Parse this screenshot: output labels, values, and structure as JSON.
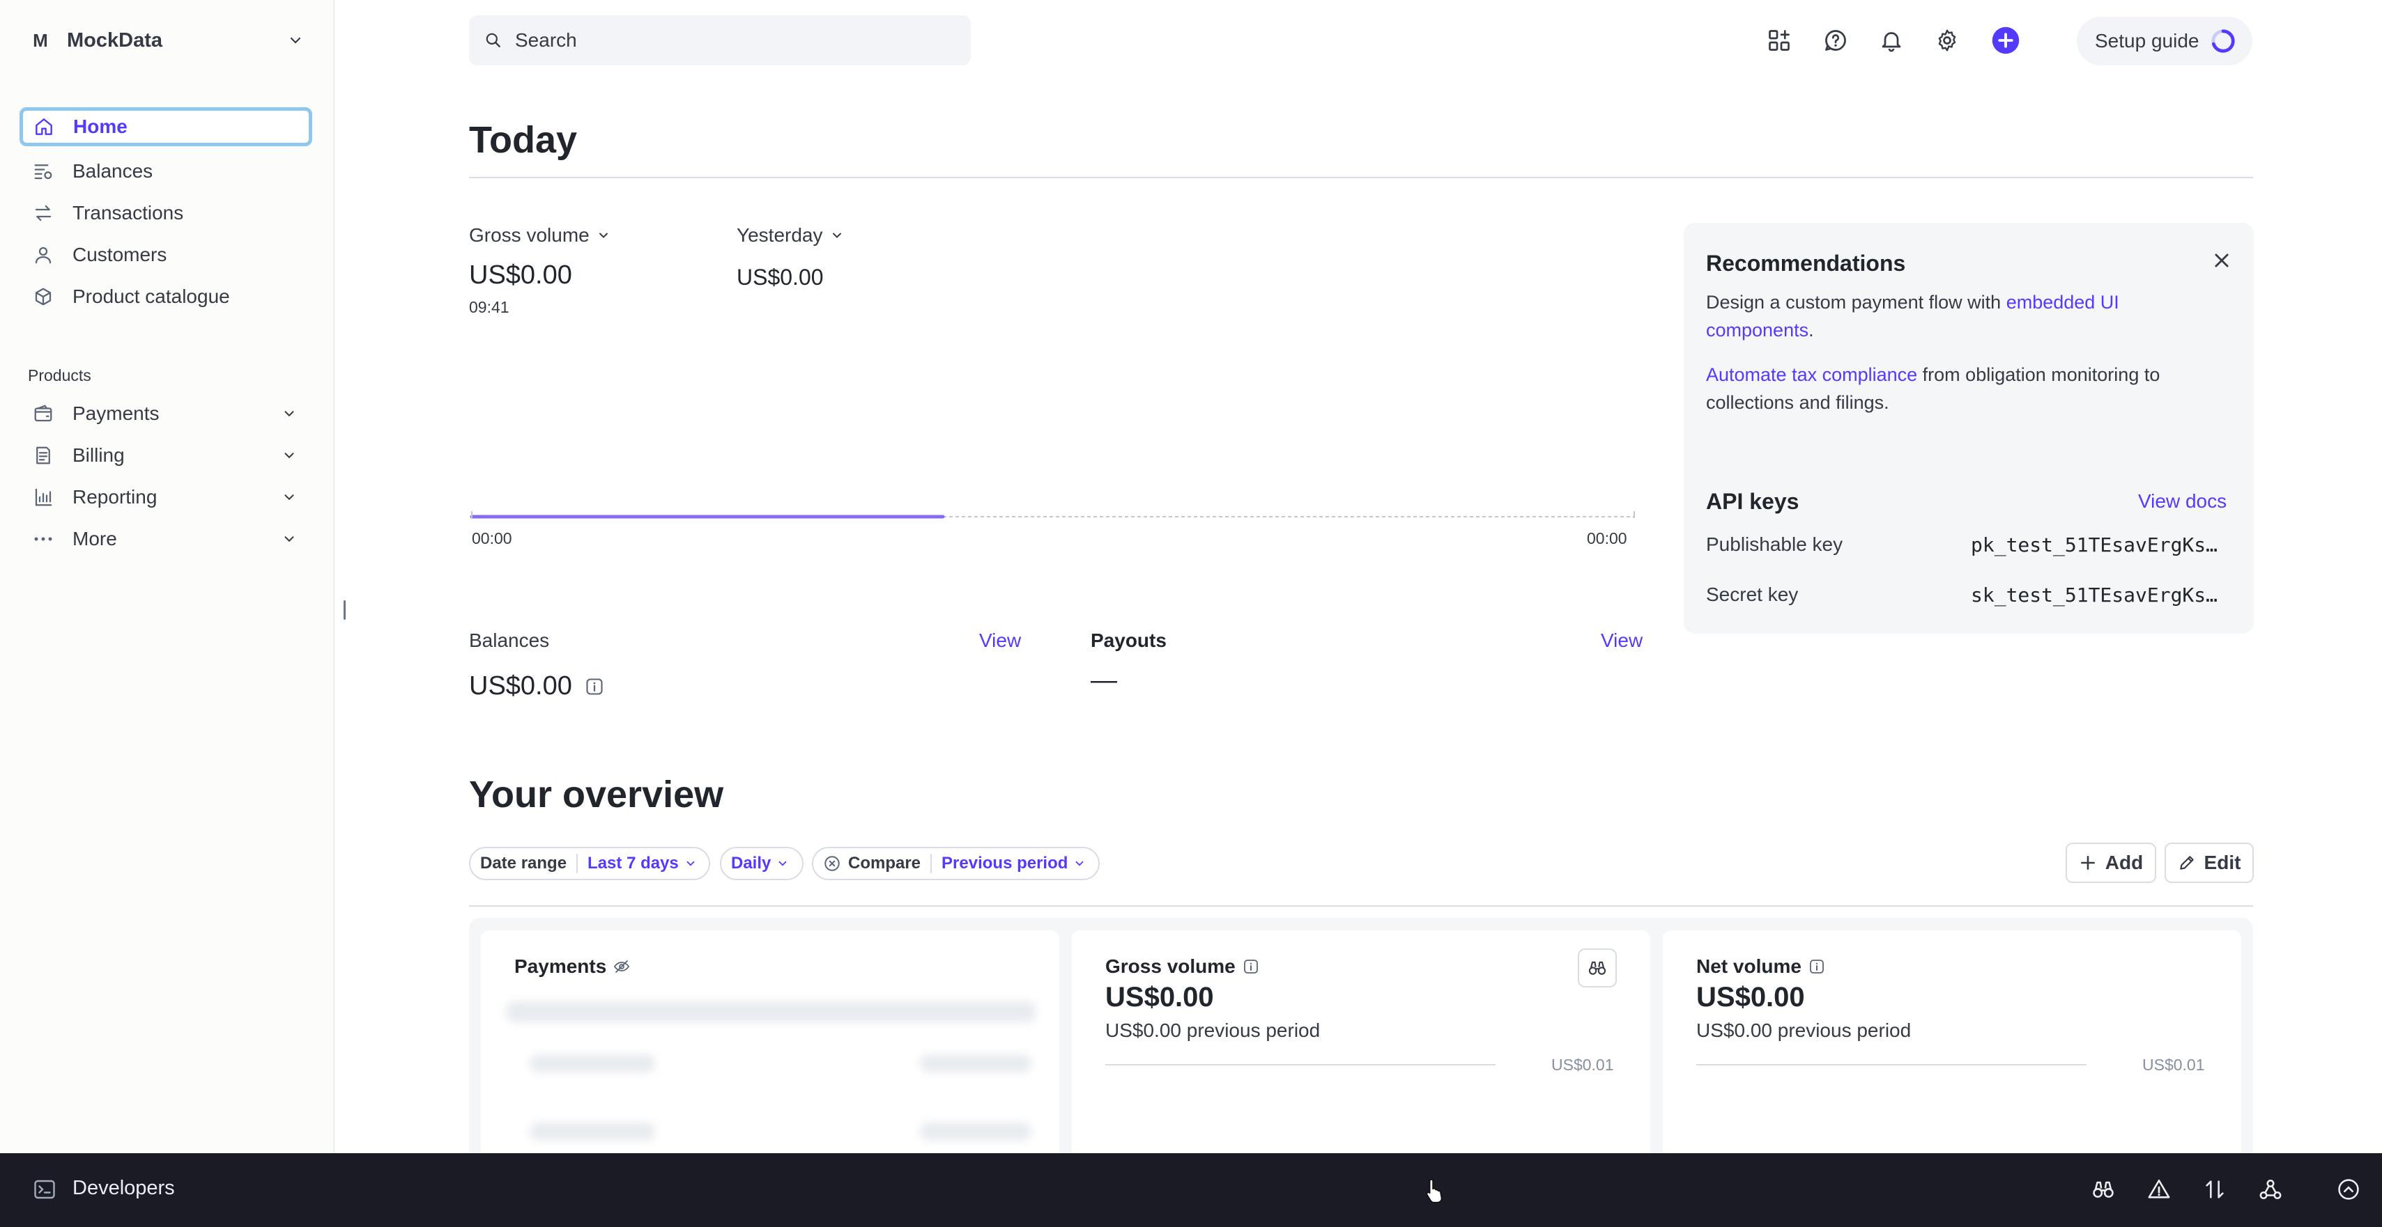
{
  "account": {
    "initial": "M",
    "name": "MockData"
  },
  "sidebar": {
    "items": [
      {
        "label": "Home",
        "icon": "home-icon"
      },
      {
        "label": "Balances",
        "icon": "balances-icon"
      },
      {
        "label": "Transactions",
        "icon": "transactions-icon"
      },
      {
        "label": "Customers",
        "icon": "customers-icon"
      },
      {
        "label": "Product catalogue",
        "icon": "product-catalogue-icon"
      }
    ],
    "section_title": "Products",
    "product_items": [
      {
        "label": "Payments",
        "icon": "payments-icon"
      },
      {
        "label": "Billing",
        "icon": "billing-icon"
      },
      {
        "label": "Reporting",
        "icon": "reporting-icon"
      },
      {
        "label": "More",
        "icon": "more-icon"
      }
    ]
  },
  "header": {
    "search_placeholder": "Search",
    "setup_guide": "Setup guide",
    "icons": [
      "apps-icon",
      "help-icon",
      "notifications-icon",
      "settings-icon",
      "create-icon"
    ],
    "accent": "#533afd"
  },
  "today": {
    "title": "Today",
    "gross_volume_label": "Gross volume",
    "gross_volume_value": "US$0.00",
    "gross_volume_time": "09:41",
    "yesterday_label": "Yesterday",
    "yesterday_value": "US$0.00",
    "chart_start": "00:00",
    "chart_end": "00:00",
    "balances_label": "Balances",
    "balances_view": "View",
    "balances_value": "US$0.00",
    "payouts_label": "Payouts",
    "payouts_view": "View",
    "payouts_value": "—"
  },
  "recommendations": {
    "title": "Recommendations",
    "line1_prefix": "Design a custom payment flow with ",
    "line1_link": "embedded UI components",
    "line1_suffix": ".",
    "line2_link": "Automate tax compliance",
    "line2_suffix": " from obligation monitoring to collections and filings.",
    "api_title": "API keys",
    "view_docs": "View docs",
    "publishable_label": "Publishable key",
    "publishable_value": "pk_test_51TEsavErgKs…",
    "secret_label": "Secret key",
    "secret_value": "sk_test_51TEsavErgKs…"
  },
  "overview": {
    "title": "Your overview",
    "date_range_key": "Date range",
    "date_range_value": "Last 7 days",
    "interval_value": "Daily",
    "compare_key": "Compare",
    "compare_value": "Previous period",
    "add_label": "Add",
    "edit_label": "Edit",
    "cards": [
      {
        "title": "Payments"
      },
      {
        "title": "Gross volume",
        "value": "US$0.00",
        "previous": "US$0.00 previous period",
        "max": "US$0.01"
      },
      {
        "title": "Net volume",
        "value": "US$0.00",
        "previous": "US$0.00 previous period",
        "max": "US$0.01"
      }
    ]
  },
  "devbar": {
    "label": "Developers",
    "icons": [
      "inspect-icon",
      "warning-icon",
      "api-requests-icon",
      "webhooks-icon",
      "expand-icon"
    ]
  }
}
